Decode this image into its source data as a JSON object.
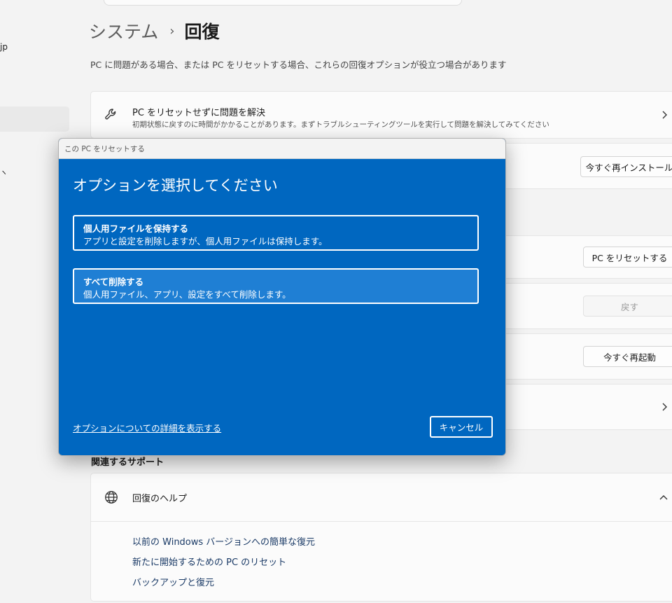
{
  "sidebar": {
    "fragment_top": "jp",
    "fragment_mid": "ヽ"
  },
  "header": {
    "breadcrumb_parent": "システム",
    "breadcrumb_separator": "›",
    "breadcrumb_current": "回復",
    "intro": "PC に問題がある場合、または PC をリセットする場合、これらの回復オプションが役立つ場合があります"
  },
  "recovery": {
    "fix_title": "PC をリセットせずに問題を解決",
    "fix_desc": "初期状態に戻すのに時間がかかることがあります。まずトラブルシューティングツールを実行して問題を解決してみてください",
    "reinstall_button": "今すぐ再インストール",
    "reset_button": "PC をリセットする",
    "goback_button": "戻す",
    "restart_button": "今すぐ再起動"
  },
  "support": {
    "heading": "関連するサポート",
    "help_title": "回復のヘルプ",
    "links": [
      "以前の Windows バージョンへの簡単な復元",
      "新たに開始するための PC のリセット",
      "バックアップと復元"
    ]
  },
  "dialog": {
    "window_title": "この PC をリセットする",
    "heading": "オプションを選択してください",
    "options": [
      {
        "title": "個人用ファイルを保持する",
        "desc": "アプリと設定を削除しますが、個人用ファイルは保持します。"
      },
      {
        "title": "すべて削除する",
        "desc": "個人用ファイル、アプリ、設定をすべて削除します。"
      }
    ],
    "details_link": "オプションについての詳細を表示する",
    "cancel_button": "キャンセル"
  },
  "colors": {
    "dialog_background": "#0067c0",
    "option_hover": "#1f7fd4",
    "page_background": "#f3f3f3",
    "link_text": "#1a3a66"
  },
  "icons": [
    "wrench-icon",
    "globe-icon",
    "chevron-right-icon",
    "chevron-up-icon"
  ]
}
